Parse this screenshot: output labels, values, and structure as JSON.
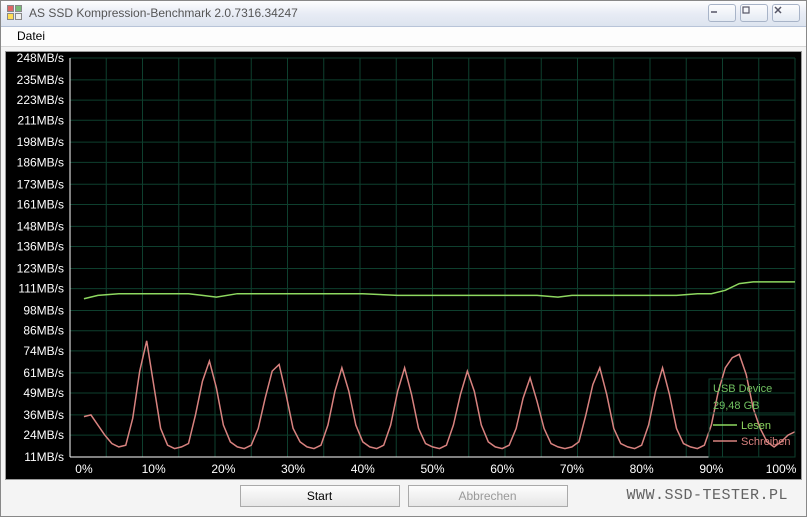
{
  "window": {
    "title": "AS SSD Kompression-Benchmark 2.0.7316.34247"
  },
  "menu": {
    "file": "Datei"
  },
  "buttons": {
    "start": "Start",
    "cancel": "Abbrechen"
  },
  "legend": {
    "device": "USB Device",
    "capacity": "29,48 GB",
    "read": "Lesen",
    "write": "Schreiben"
  },
  "watermark": "www.ssd-tester.pl",
  "chart_data": {
    "type": "line",
    "xlabel": "",
    "ylabel": "",
    "x_unit": "%",
    "y_unit": "MB/s",
    "xlim": [
      -2,
      102
    ],
    "ylim": [
      11,
      248
    ],
    "y_ticks": [
      11,
      24,
      36,
      49,
      61,
      74,
      86,
      98,
      111,
      123,
      136,
      148,
      161,
      173,
      186,
      198,
      211,
      223,
      235,
      248
    ],
    "x_ticks": [
      0,
      10,
      20,
      30,
      40,
      50,
      60,
      70,
      80,
      90,
      100
    ],
    "series": [
      {
        "name": "Lesen",
        "color": "#8ed860",
        "x": [
          0,
          2,
          5,
          8,
          12,
          15,
          17,
          19,
          22,
          25,
          30,
          35,
          40,
          45,
          50,
          55,
          60,
          65,
          68,
          70,
          75,
          80,
          85,
          88,
          90,
          92,
          94,
          96,
          98,
          100,
          102
        ],
        "y": [
          105,
          107,
          108,
          108,
          108,
          108,
          107,
          106,
          108,
          108,
          108,
          108,
          108,
          107,
          107,
          107,
          107,
          107,
          106,
          107,
          107,
          107,
          107,
          108,
          108,
          110,
          114,
          115,
          115,
          115,
          115
        ]
      },
      {
        "name": "Schreiben",
        "color": "#d8827f",
        "x": [
          0,
          1,
          2,
          3,
          4,
          5,
          6,
          7,
          8,
          9,
          10,
          11,
          12,
          13,
          14,
          15,
          16,
          17,
          18,
          19,
          20,
          21,
          22,
          23,
          24,
          25,
          26,
          27,
          28,
          29,
          30,
          31,
          32,
          33,
          34,
          35,
          36,
          37,
          38,
          39,
          40,
          41,
          42,
          43,
          44,
          45,
          46,
          47,
          48,
          49,
          50,
          51,
          52,
          53,
          54,
          55,
          56,
          57,
          58,
          59,
          60,
          61,
          62,
          63,
          64,
          65,
          66,
          67,
          68,
          69,
          70,
          71,
          72,
          73,
          74,
          75,
          76,
          77,
          78,
          79,
          80,
          81,
          82,
          83,
          84,
          85,
          86,
          87,
          88,
          89,
          90,
          91,
          92,
          93,
          94,
          95,
          96,
          97,
          98,
          99,
          100,
          101,
          102
        ],
        "y": [
          35,
          36,
          30,
          24,
          19,
          17,
          18,
          34,
          62,
          80,
          54,
          28,
          18,
          16,
          17,
          19,
          36,
          56,
          68,
          52,
          30,
          20,
          17,
          16,
          18,
          28,
          46,
          62,
          66,
          48,
          28,
          20,
          17,
          16,
          18,
          30,
          50,
          64,
          50,
          30,
          20,
          17,
          16,
          18,
          30,
          50,
          64,
          48,
          28,
          19,
          17,
          16,
          18,
          30,
          48,
          62,
          50,
          30,
          20,
          17,
          16,
          18,
          28,
          46,
          58,
          44,
          28,
          19,
          17,
          16,
          17,
          20,
          36,
          54,
          64,
          48,
          28,
          19,
          17,
          16,
          18,
          30,
          50,
          64,
          48,
          28,
          19,
          17,
          16,
          18,
          30,
          50,
          64,
          70,
          72,
          60,
          40,
          28,
          20,
          17,
          20,
          24,
          26
        ]
      }
    ],
    "grid": true
  }
}
